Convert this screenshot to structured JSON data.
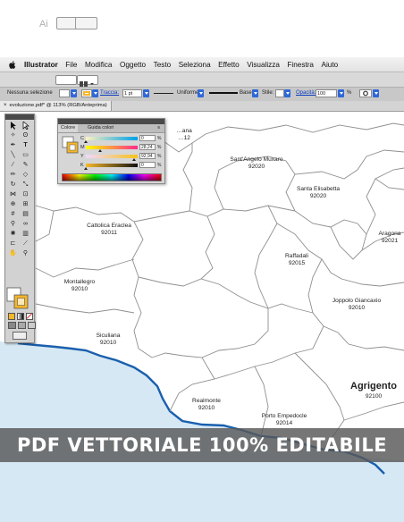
{
  "menubar": {
    "app_name": "Illustrator",
    "items": [
      "File",
      "Modifica",
      "Oggetto",
      "Testo",
      "Seleziona",
      "Effetto",
      "Visualizza",
      "Finestra",
      "Aiuto"
    ]
  },
  "controlbar": {
    "selection_label": "Nessuna selezione",
    "stroke_link": "Traccia:",
    "stroke_weight": "1 pt",
    "stroke_profile": "Uniforme",
    "brush": "Base",
    "style_label": "Stile:",
    "opacity_link": "Opacità:",
    "opacity_value": "100",
    "opacity_unit": "%"
  },
  "document_tab": {
    "title": "evoluzione.pdf* @ 113% (RGB/Anteprima)"
  },
  "color_panel": {
    "tab_active": "Colore",
    "tab_other": "Guida colori",
    "channels": [
      {
        "label": "C",
        "value": "0",
        "unit": "%",
        "level": 0.0,
        "gradient": "linear-gradient(90deg,#fff2bf,#00a0e6)"
      },
      {
        "label": "M",
        "value": "28,24",
        "unit": "%",
        "level": 0.2824,
        "gradient": "linear-gradient(90deg,#ffff00,#ff2a8a)"
      },
      {
        "label": "Y",
        "value": "92,94",
        "unit": "%",
        "level": 0.9294,
        "gradient": "linear-gradient(90deg,#f0d8ff,#f6c21a)"
      },
      {
        "label": "K",
        "value": "0",
        "unit": "%",
        "level": 0.0,
        "gradient": "linear-gradient(90deg,#f7b92a,#111111)"
      }
    ],
    "fill_color": "#f5b628"
  },
  "map": {
    "places": [
      {
        "name": "…ana",
        "code": "…12"
      },
      {
        "name": "Sant'Angelo Muxaro",
        "code": "92020"
      },
      {
        "name": "Santa Elisabetta",
        "code": "92020"
      },
      {
        "name": "Cattolica Eraclea",
        "code": "92011"
      },
      {
        "name": "Aragona",
        "code": "92021"
      },
      {
        "name": "Raffadali",
        "code": "92015"
      },
      {
        "name": "Montallegro",
        "code": "92010"
      },
      {
        "name": "Joppolo Giancaxio",
        "code": "92010"
      },
      {
        "name": "Siculiana",
        "code": "92010"
      },
      {
        "name": "Agrigento",
        "code": "92100"
      },
      {
        "name": "Realmonte",
        "code": "92010"
      },
      {
        "name": "Porto Empedocle",
        "code": "92014"
      }
    ],
    "sea_color": "#d6e8f3",
    "coast_color": "#1a5fae"
  },
  "banner": {
    "text": "PDF VETTORIALE 100% EDITABILE"
  }
}
